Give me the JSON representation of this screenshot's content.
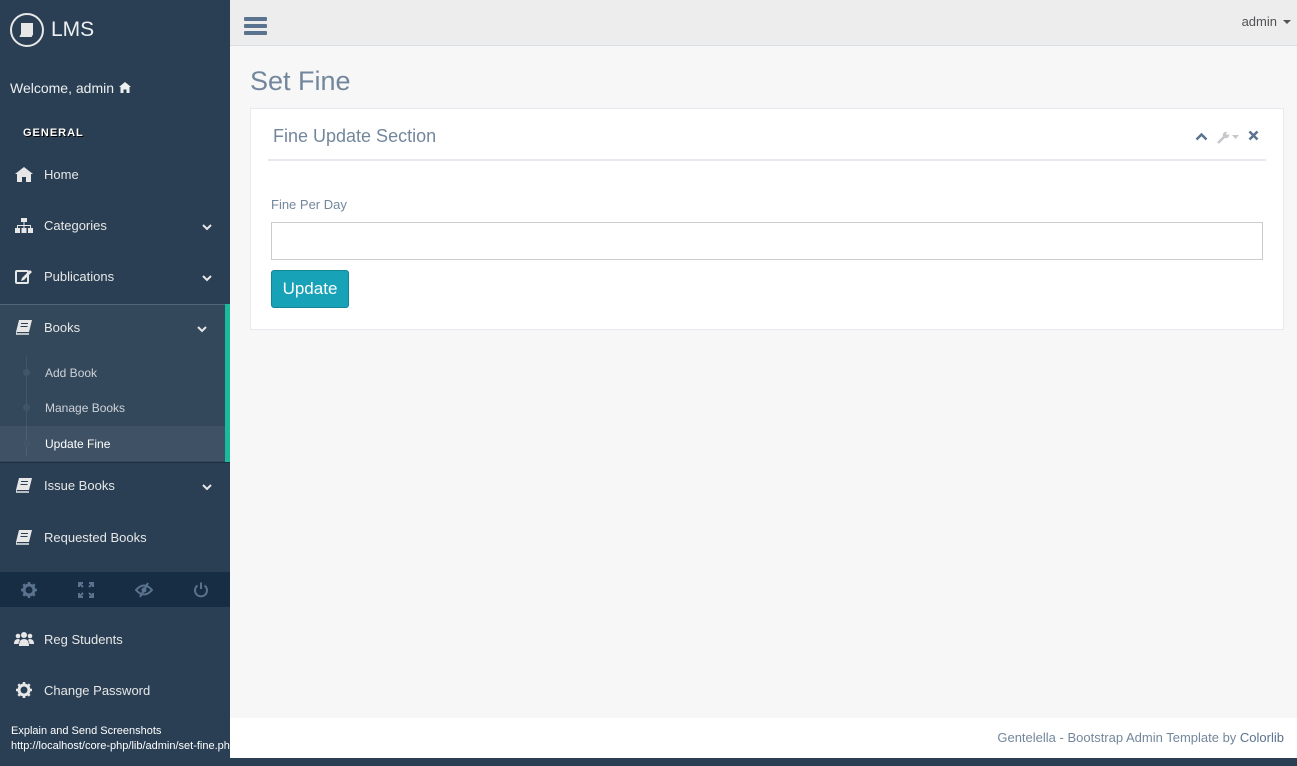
{
  "brand": {
    "name": "LMS"
  },
  "welcome": {
    "text": "Welcome, admin"
  },
  "sidebar": {
    "section_title": "GENERAL",
    "items": [
      {
        "label": "Home"
      },
      {
        "label": "Categories"
      },
      {
        "label": "Publications"
      },
      {
        "label": "Books"
      },
      {
        "label": "Issue Books"
      },
      {
        "label": "Requested Books"
      },
      {
        "label": "Reg Students"
      },
      {
        "label": "Change Password"
      }
    ],
    "books_submenu": [
      {
        "label": "Add Book"
      },
      {
        "label": "Manage Books"
      },
      {
        "label": "Update Fine"
      }
    ]
  },
  "topnav": {
    "user": "admin"
  },
  "page": {
    "title": "Set Fine",
    "panel_title": "Fine Update Section",
    "field_label": "Fine Per Day",
    "field_value": "",
    "update_label": "Update"
  },
  "footer": {
    "text": "Gentelella - Bootstrap Admin Template by ",
    "link": "Colorlib"
  },
  "status_overlay": {
    "line1": "Explain and Send Screenshots",
    "line2": "http://localhost/core-php/lib/admin/set-fine.php"
  },
  "colors": {
    "sidebar_bg": "#2A3F54",
    "accent": "#1ABB9C",
    "button": "#17A2B8",
    "text_muted": "#73879C"
  }
}
